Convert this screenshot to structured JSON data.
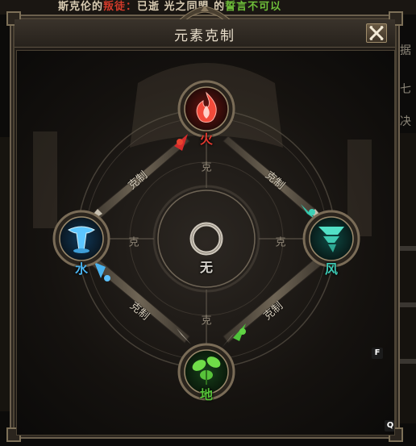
{
  "background": {
    "top_text": {
      "part1": "斯克伦的",
      "part2": "叛徒：",
      "part3": "已逝  光之同盟 的",
      "part4": "誓言不可以"
    },
    "right_text_a": "据",
    "right_text_b": "七",
    "right_text_c": "决"
  },
  "dialog": {
    "title": "元素克制",
    "close_icon": "close-icon"
  },
  "elements": {
    "fire": {
      "label": "火",
      "color": "#e0392f"
    },
    "wind": {
      "label": "风",
      "color": "#3ec9b3"
    },
    "earth": {
      "label": "地",
      "color": "#55c238"
    },
    "water": {
      "label": "水",
      "color": "#4ab3ee"
    },
    "none": {
      "label": "无",
      "color": "#d9d6cf"
    }
  },
  "relations": {
    "ke_top": "克",
    "ke_left": "克",
    "ke_right": "克",
    "ke_bottom": "克",
    "arrow_fire_water": "克制",
    "arrow_fire_wind": "克制",
    "arrow_water_earth": "克制",
    "arrow_earth_wind": "克制"
  },
  "hotkeys": {
    "f": "F",
    "q": "Q"
  }
}
